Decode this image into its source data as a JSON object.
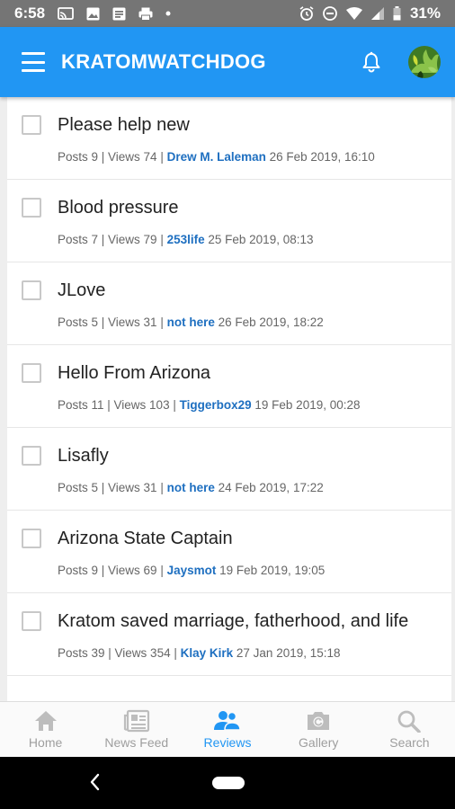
{
  "status_bar": {
    "time": "6:58",
    "battery": "31%"
  },
  "app_bar": {
    "title": "KRATOMWATCHDOG"
  },
  "threads": [
    {
      "title": "Please help new",
      "posts": "Posts 9 | Views 74 |",
      "author": "Drew M. Laleman",
      "date": "26 Feb 2019, 16:10"
    },
    {
      "title": "Blood pressure",
      "posts": "Posts 7 | Views 79 |",
      "author": "253life",
      "date": "25 Feb 2019, 08:13"
    },
    {
      "title": "JLove",
      "posts": "Posts 5 | Views 31 |",
      "author": "not here",
      "date": "26 Feb 2019, 18:22"
    },
    {
      "title": "Hello From Arizona",
      "posts": "Posts 11 | Views 103 |",
      "author": "Tiggerbox29",
      "date": "19 Feb 2019, 00:28"
    },
    {
      "title": "Lisafly",
      "posts": "Posts 5 | Views 31 |",
      "author": "not here",
      "date": "24 Feb 2019, 17:22"
    },
    {
      "title": "Arizona State Captain",
      "posts": "Posts 9 | Views 69 |",
      "author": "Jaysmot",
      "date": "19 Feb 2019, 19:05"
    },
    {
      "title": "Kratom saved marriage, fatherhood, and life",
      "posts": "Posts 39 | Views 354 |",
      "author": "Klay Kirk",
      "date": "27 Jan 2019, 15:18"
    }
  ],
  "bottom_nav": [
    {
      "label": "Home",
      "icon": "home-icon"
    },
    {
      "label": "News Feed",
      "icon": "news-feed-icon"
    },
    {
      "label": "Reviews",
      "icon": "reviews-icon",
      "active": true
    },
    {
      "label": "Gallery",
      "icon": "gallery-icon"
    },
    {
      "label": "Search",
      "icon": "search-icon"
    }
  ],
  "colors": {
    "primary": "#2196f3",
    "link": "#1e6fc0",
    "status_bar": "#757575"
  }
}
